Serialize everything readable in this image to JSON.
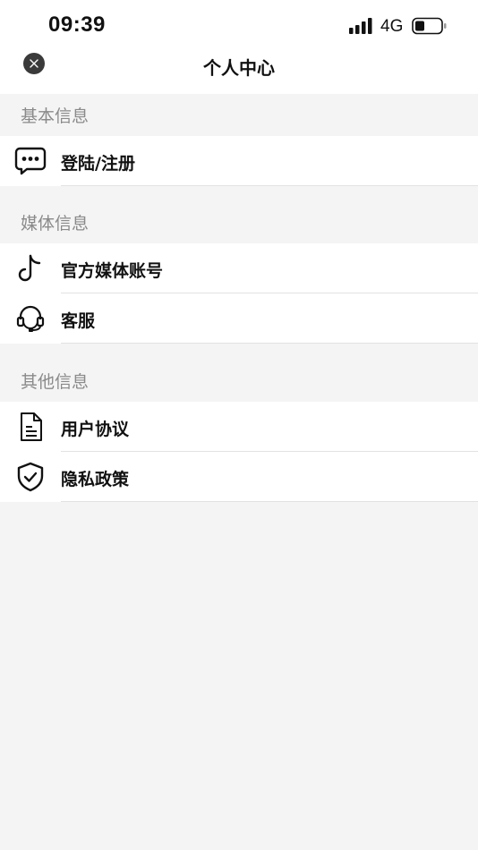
{
  "status_bar": {
    "time": "09:39",
    "network": "4G",
    "icons": [
      "signal-icon",
      "battery-icon"
    ]
  },
  "nav": {
    "title": "个人中心",
    "close_icon": "close-icon"
  },
  "sections": [
    {
      "header": "基本信息",
      "items": [
        {
          "label": "登陆/注册",
          "icon": "message-icon"
        }
      ]
    },
    {
      "header": "媒体信息",
      "items": [
        {
          "label": "官方媒体账号",
          "icon": "tiktok-icon"
        },
        {
          "label": "客服",
          "icon": "headset-icon"
        }
      ]
    },
    {
      "header": "其他信息",
      "items": [
        {
          "label": "用户协议",
          "icon": "document-icon"
        },
        {
          "label": "隐私政策",
          "icon": "shield-icon"
        }
      ]
    }
  ],
  "colors": {
    "background": "#f4f4f4",
    "row": "#ffffff",
    "section_text": "#8a8a8a",
    "text": "#111111",
    "close_button": "#3a3a3a"
  }
}
